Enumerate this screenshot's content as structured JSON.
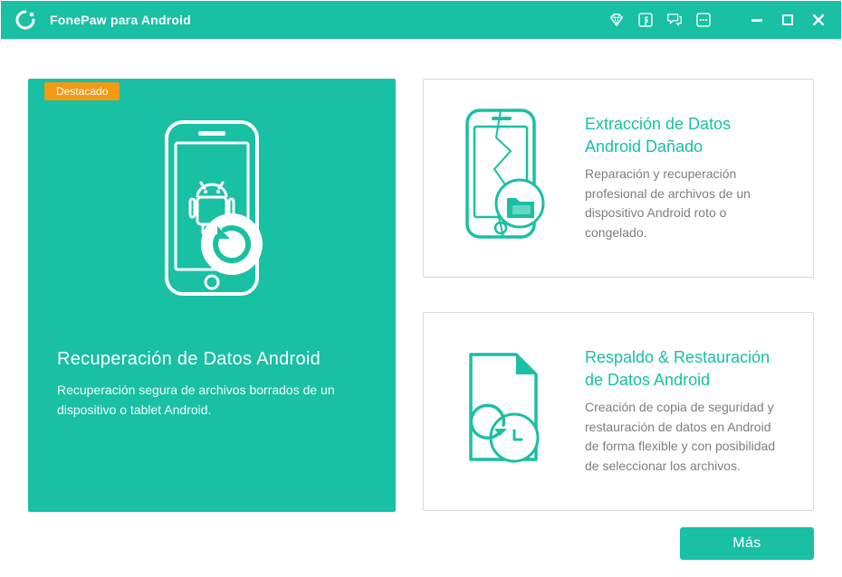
{
  "app": {
    "title": "FonePaw para Android"
  },
  "featured": {
    "badge": "Destacado",
    "title": "Recuperación de Datos Android",
    "desc": "Recuperación segura de archivos borrados de un dispositivo o tablet Android."
  },
  "cards": {
    "broken": {
      "title": "Extracción de Datos Android Dañado",
      "desc": "Reparación y recuperación profesional de archivos de un dispositivo Android roto o congelado."
    },
    "backup": {
      "title": "Respaldo & Restauración de Datos Android",
      "desc": "Creación de copia de seguridad y restauración de datos en Android de forma flexible y con posibilidad de seleccionar los archivos."
    }
  },
  "buttons": {
    "more": "Más"
  },
  "colors": {
    "teal": "#19c0a3",
    "orange": "#f29a13",
    "text_gray": "#7e7e7e",
    "border_gray": "#d9d9d9"
  }
}
